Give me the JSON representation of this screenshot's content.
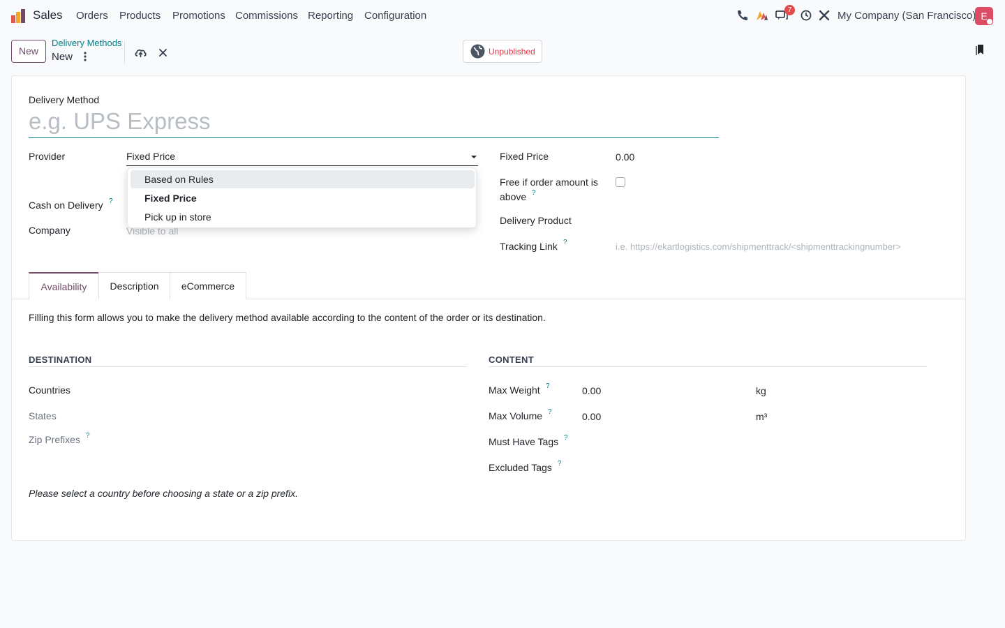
{
  "navbar": {
    "app_name": "Sales",
    "menu": [
      "Orders",
      "Products",
      "Promotions",
      "Commissions",
      "Reporting",
      "Configuration"
    ],
    "message_count": "7",
    "company": "My Company (San Francisco)",
    "avatar_letter": "E",
    "icons": [
      "phone-icon",
      "activity-icon",
      "chat-icon",
      "clock-icon",
      "tools-icon"
    ]
  },
  "control_panel": {
    "new_button": "New",
    "breadcrumb_parent": "Delivery Methods",
    "breadcrumb_current": "New",
    "publish_status": "Unpublished"
  },
  "form": {
    "title_label": "Delivery Method",
    "title_placeholder": "e.g. UPS Express",
    "provider_label": "Provider",
    "provider_value": "Fixed Price",
    "provider_options": [
      "Based on Rules",
      "Fixed Price",
      "Pick up in store"
    ],
    "cash_on_delivery_label": "Cash on Delivery",
    "company_label": "Company",
    "company_placeholder": "Visible to all",
    "fixed_price_label": "Fixed Price",
    "fixed_price_value": "0.00",
    "free_label_line1": "Free if order amount is",
    "free_label_line2": "above",
    "delivery_product_label": "Delivery Product",
    "tracking_link_label": "Tracking Link",
    "tracking_link_placeholder": "i.e. https://ekartlogistics.com/shipmenttrack/<shipmenttrackingnumber>",
    "help_mark": "?"
  },
  "tabs": [
    "Availability",
    "Description",
    "eCommerce"
  ],
  "availability": {
    "intro": "Filling this form allows you to make the delivery method available according to the content of the order or its destination.",
    "destination_head": "DESTINATION",
    "content_head": "CONTENT",
    "countries_label": "Countries",
    "states_label": "States",
    "zip_label": "Zip Prefixes",
    "max_weight_label": "Max Weight",
    "max_weight_value": "0.00",
    "weight_unit": "kg",
    "max_volume_label": "Max Volume",
    "max_volume_value": "0.00",
    "volume_unit": "m³",
    "must_tags_label": "Must Have Tags",
    "excluded_tags_label": "Excluded Tags",
    "note": "Please select a country before choosing a state or a zip prefix."
  }
}
